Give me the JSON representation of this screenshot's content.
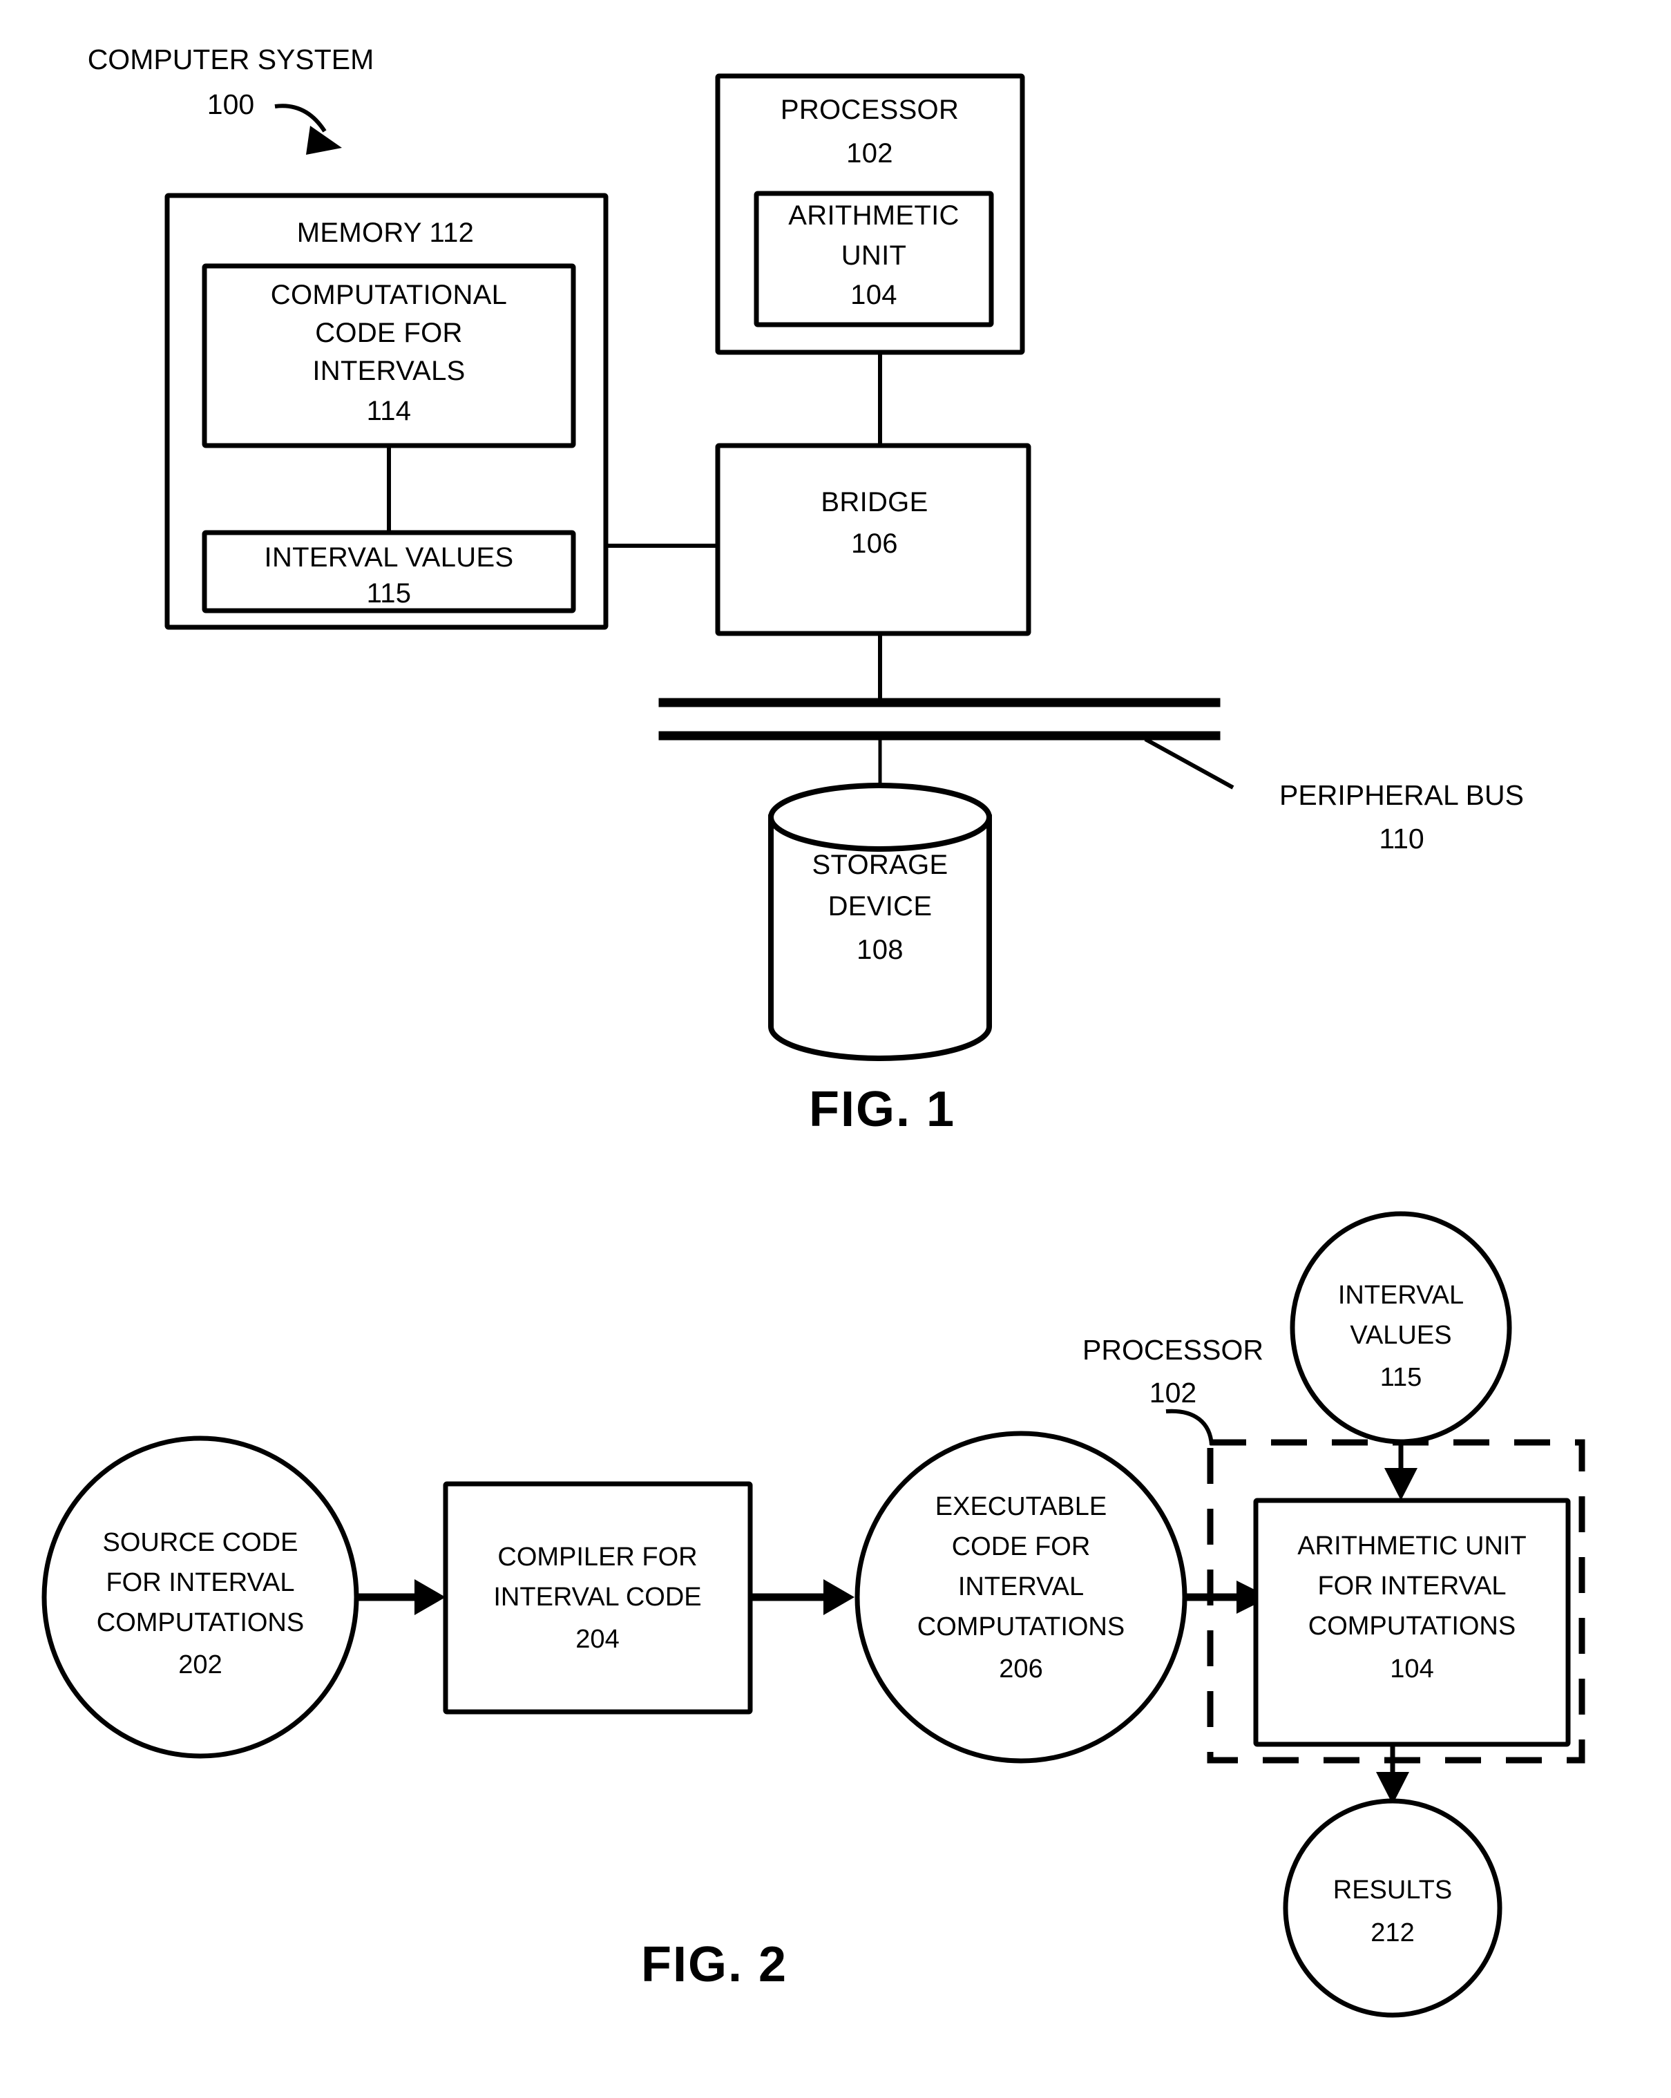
{
  "figures": [
    {
      "id": "fig1",
      "caption": "FIG. 1",
      "callouts": {
        "system_title_line1": "COMPUTER SYSTEM",
        "system_title_line2": "100",
        "peripheral_bus_line1": "PERIPHERAL BUS",
        "peripheral_bus_line2": "110"
      },
      "blocks": {
        "memory": {
          "title": "MEMORY 112",
          "computational_code": {
            "line1": "COMPUTATIONAL",
            "line2": "CODE FOR",
            "line3": "INTERVALS",
            "ref": "114"
          },
          "interval_values": {
            "line1": "INTERVAL VALUES",
            "ref": "115"
          }
        },
        "processor": {
          "line1": "PROCESSOR",
          "ref": "102",
          "arithmetic_unit": {
            "line1": "ARITHMETIC",
            "line2": "UNIT",
            "ref": "104"
          }
        },
        "bridge": {
          "line1": "BRIDGE",
          "ref": "106"
        },
        "storage_device": {
          "line1": "STORAGE",
          "line2": "DEVICE",
          "ref": "108"
        }
      }
    },
    {
      "id": "fig2",
      "caption": "FIG. 2",
      "callouts": {
        "processor_line1": "PROCESSOR",
        "processor_line2": "102"
      },
      "nodes": {
        "source_code": {
          "line1": "SOURCE CODE",
          "line2": "FOR INTERVAL",
          "line3": "COMPUTATIONS",
          "ref": "202"
        },
        "compiler": {
          "line1": "COMPILER FOR",
          "line2": "INTERVAL CODE",
          "ref": "204"
        },
        "executable_code": {
          "line1": "EXECUTABLE",
          "line2": "CODE FOR",
          "line3": "INTERVAL",
          "line4": "COMPUTATIONS",
          "ref": "206"
        },
        "interval_values": {
          "line1": "INTERVAL",
          "line2": "VALUES",
          "ref": "115"
        },
        "arithmetic_unit": {
          "line1": "ARITHMETIC UNIT",
          "line2": "FOR INTERVAL",
          "line3": "COMPUTATIONS",
          "ref": "104"
        },
        "results": {
          "line1": "RESULTS",
          "ref": "212"
        }
      }
    }
  ],
  "colors": {
    "ink": "#000000",
    "paper": "#ffffff"
  }
}
